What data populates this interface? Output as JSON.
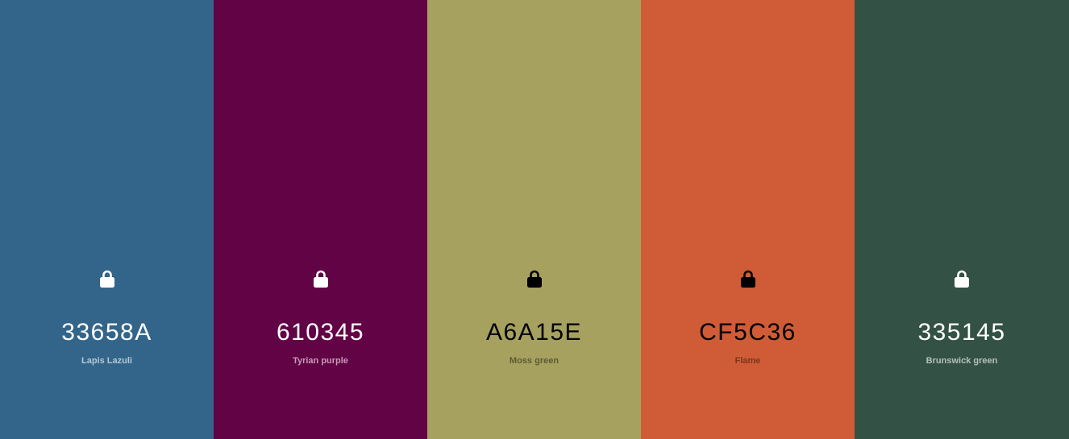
{
  "swatches": [
    {
      "hex": "33658A",
      "name": "Lapis Lazuli",
      "bg": "#33658A",
      "fg": "#FFFFFF",
      "name_color": "#B7C6D3",
      "lock_icon": "lock-icon"
    },
    {
      "hex": "610345",
      "name": "Tyrian purple",
      "bg": "#610345",
      "fg": "#FFFFFF",
      "name_color": "#C79BB8",
      "lock_icon": "lock-icon"
    },
    {
      "hex": "A6A15E",
      "name": "Moss green",
      "bg": "#A6A15E",
      "fg": "#000000",
      "name_color": "#5E5B36",
      "lock_icon": "lock-icon"
    },
    {
      "hex": "CF5C36",
      "name": "Flame",
      "bg": "#CF5C36",
      "fg": "#000000",
      "name_color": "#7A361F",
      "lock_icon": "lock-icon"
    },
    {
      "hex": "335145",
      "name": "Brunswick green",
      "bg": "#335145",
      "fg": "#FFFFFF",
      "name_color": "#B4C1BB",
      "lock_icon": "lock-icon"
    }
  ]
}
